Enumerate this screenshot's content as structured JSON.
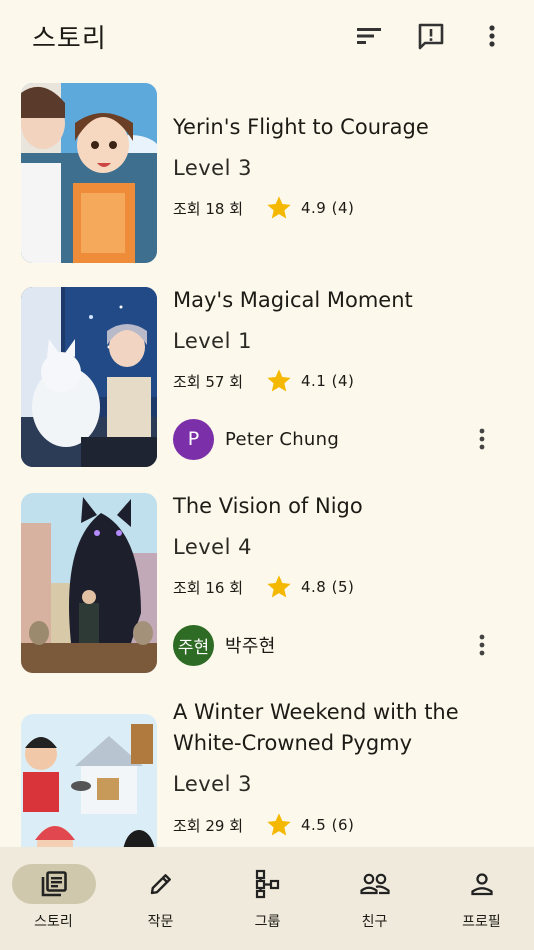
{
  "app_bar": {
    "title": "스토리",
    "icons": [
      "sort-icon",
      "feedback-icon",
      "more-vert-icon"
    ]
  },
  "stories": [
    {
      "title": "Yerin's Flight to Courage",
      "level": "Level 3",
      "views": "조회 18 회",
      "rating": "4.9 (4)",
      "author": null
    },
    {
      "title": "May's Magical Moment",
      "level": "Level 1",
      "views": "조회 57 회",
      "rating": "4.1 (4)",
      "author": {
        "initial": "P",
        "name": "Peter Chung",
        "color": "#7b2fa8"
      }
    },
    {
      "title": "The Vision of Nigo",
      "level": "Level 4",
      "views": "조회 16 회",
      "rating": "4.8 (5)",
      "author": {
        "initial": "주현",
        "name": "박주현",
        "color": "#2e6b24"
      }
    },
    {
      "title": "A Winter Weekend with the White-Crowned Pygmy",
      "level": "Level 3",
      "views": "조회 29 회",
      "rating": "4.5 (6)",
      "author": null
    }
  ],
  "bottom_nav": [
    {
      "label": "스토리",
      "icon": "stories-icon",
      "active": true
    },
    {
      "label": "작문",
      "icon": "pencil-icon",
      "active": false
    },
    {
      "label": "그룹",
      "icon": "group-tree-icon",
      "active": false
    },
    {
      "label": "친구",
      "icon": "friends-icon",
      "active": false
    },
    {
      "label": "프로필",
      "icon": "profile-icon",
      "active": false
    }
  ],
  "colors": {
    "background": "#fdf8ec",
    "nav_background": "#efeadb",
    "nav_active_pill": "#cfc8ad",
    "star": "#f5b800"
  }
}
